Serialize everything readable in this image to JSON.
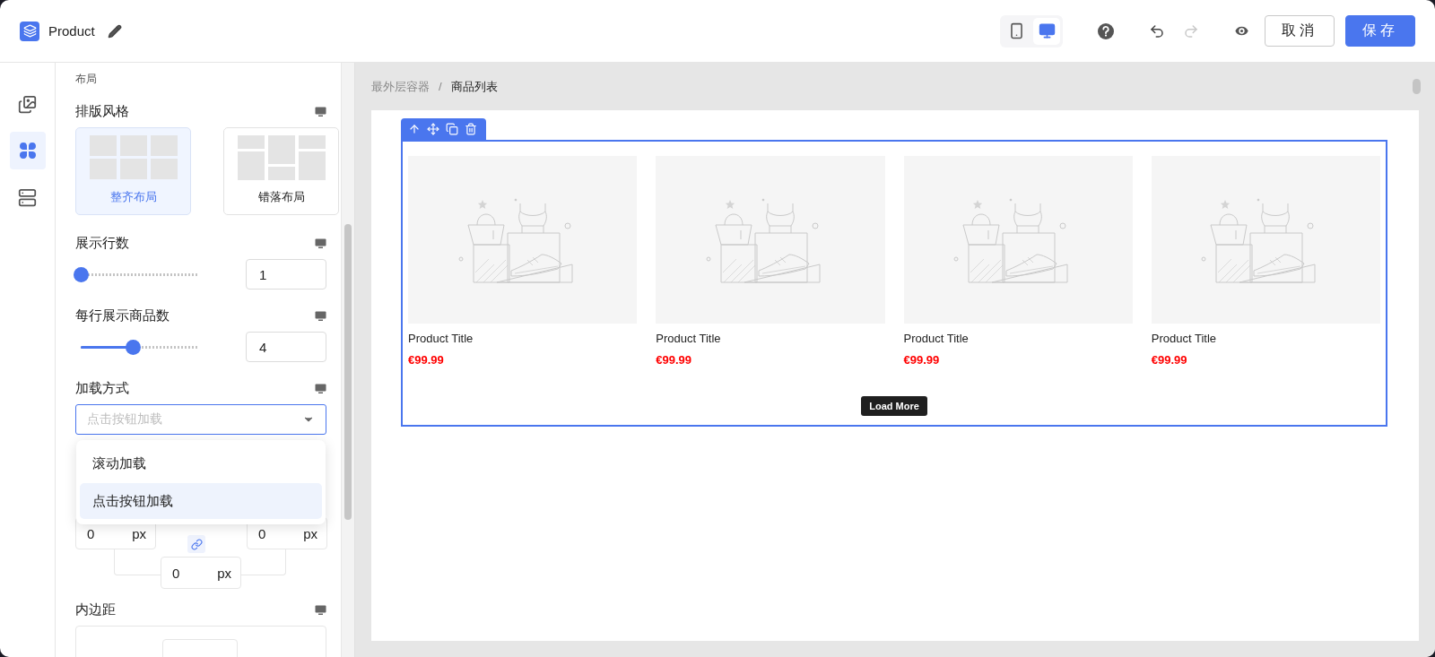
{
  "header": {
    "title": "Product",
    "devices": [
      {
        "kind": "mobile",
        "selected": false
      },
      {
        "kind": "desktop",
        "selected": true
      }
    ],
    "history": [
      {
        "kind": "undo",
        "disabled": false
      },
      {
        "kind": "redo",
        "disabled": true
      }
    ],
    "buttons": [
      {
        "label": "取消",
        "kind": "secondary"
      },
      {
        "label": "保存",
        "kind": "primary"
      }
    ]
  },
  "rail": [
    {
      "kind": "images",
      "selected": false
    },
    {
      "kind": "components",
      "selected": true
    },
    {
      "kind": "list",
      "selected": false
    }
  ],
  "panel": {
    "section": "布局",
    "layout_style": {
      "label": "排版风格",
      "options": [
        {
          "label": "整齐布局",
          "kind": "grid",
          "selected": true
        },
        {
          "label": "错落布局",
          "kind": "masonry",
          "selected": false
        }
      ]
    },
    "rows": {
      "label": "展示行数",
      "level": 0,
      "value": "1"
    },
    "per_row": {
      "label": "每行展示商品数",
      "level": 0.44,
      "value": "4"
    },
    "load_mode": {
      "label": "加载方式",
      "placeholder": "点击按钮加载",
      "open": true,
      "options": [
        {
          "label": "滚动加载",
          "selected": false
        },
        {
          "label": "点击按钮加载",
          "selected": true
        }
      ]
    },
    "margin": [
      {
        "value": "0",
        "unit": "px"
      },
      {
        "value": "0",
        "unit": "px"
      },
      {
        "value": "0",
        "unit": "px"
      }
    ],
    "padding": {
      "label": "内边距"
    }
  },
  "canvas": {
    "breadcrumb": [
      "最外层容器",
      "商品列表"
    ],
    "breadcrumb_separator": "/",
    "products": [
      {
        "title": "Product Title",
        "price": "€99.99"
      },
      {
        "title": "Product Title",
        "price": "€99.99"
      },
      {
        "title": "Product Title",
        "price": "€99.99"
      },
      {
        "title": "Product Title",
        "price": "€99.99"
      }
    ],
    "load_more": "Load More"
  }
}
